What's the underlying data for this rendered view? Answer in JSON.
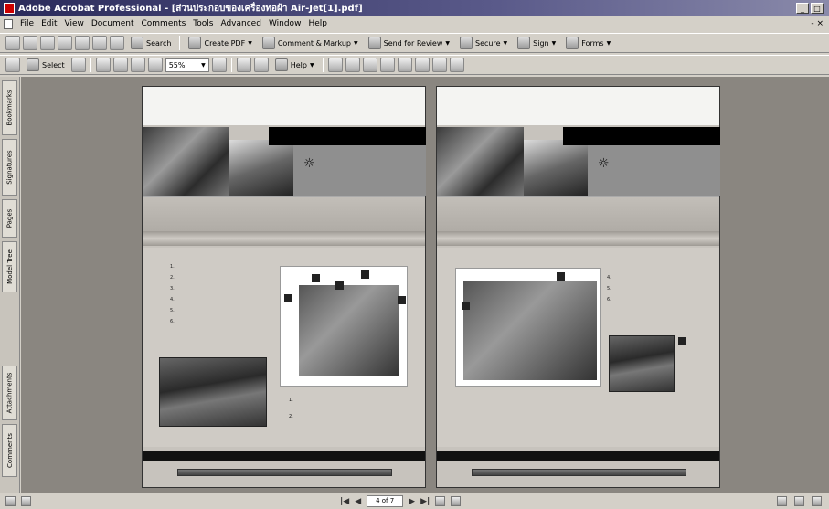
{
  "window": {
    "title": "Adobe Acrobat Professional - [ส่วนประกอบของเครื่องทอผ้า Air-Jet[1].pdf]",
    "minimize": "_",
    "maximize": "□",
    "close": "×"
  },
  "menu": {
    "items": [
      "File",
      "Edit",
      "View",
      "Document",
      "Comments",
      "Tools",
      "Advanced",
      "Window",
      "Help"
    ],
    "doc_close": "- ×"
  },
  "toolbar1": {
    "search": "Search",
    "create_pdf": "Create PDF",
    "comment_markup": "Comment & Markup",
    "send_review": "Send for Review",
    "secure": "Secure",
    "sign": "Sign",
    "forms": "Forms"
  },
  "toolbar2": {
    "select": "Select",
    "zoom_value": "55%",
    "help": "Help"
  },
  "nav_tabs": [
    "Bookmarks",
    "Signatures",
    "Pages",
    "Model Tree",
    "Attachments",
    "Comments"
  ],
  "page_left": {
    "bullets": [
      "1.",
      "2.",
      "3.",
      "4.",
      "5.",
      "6."
    ],
    "captions": [
      "1.",
      "2."
    ]
  },
  "page_right": {
    "bullets": [
      "4.",
      "5.",
      "6."
    ]
  },
  "statusbar": {
    "page_indicator": "4 of 7",
    "first": "|◀",
    "prev": "◀",
    "next": "▶",
    "last": "▶|"
  }
}
